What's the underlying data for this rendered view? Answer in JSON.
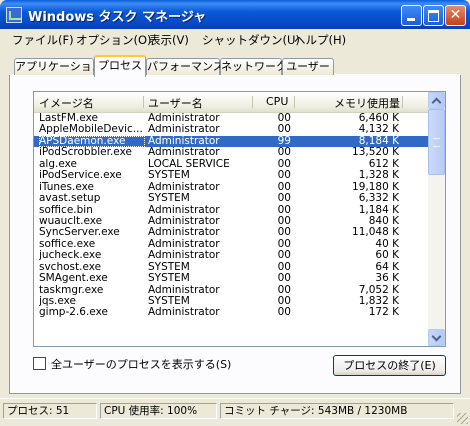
{
  "window": {
    "title": "Windows タスク マネージャ"
  },
  "menu": [
    "ファイル(F)",
    "オプション(O)",
    "表示(V)",
    "シャットダウン(U)",
    "ヘルプ(H)"
  ],
  "tabs": [
    "アプリケーション",
    "プロセス",
    "パフォーマンス",
    "ネットワーク",
    "ユーザー"
  ],
  "active_tab": "プロセス",
  "columns": [
    "イメージ名",
    "ユーザー名",
    "CPU",
    "メモリ使用量"
  ],
  "processes": [
    {
      "name": "LastFM.exe",
      "user": "Administrator",
      "cpu": "00",
      "mem": "6,460 K"
    },
    {
      "name": "AppleMobileDevic...",
      "user": "Administrator",
      "cpu": "00",
      "mem": "4,132 K"
    },
    {
      "name": "APSDaemon.exe",
      "user": "Administrator",
      "cpu": "99",
      "mem": "8,184 K",
      "selected": true
    },
    {
      "name": "iPodScrobbler.exe",
      "user": "Administrator",
      "cpu": "00",
      "mem": "13,520 K"
    },
    {
      "name": "alg.exe",
      "user": "LOCAL SERVICE",
      "cpu": "00",
      "mem": "612 K"
    },
    {
      "name": "iPodService.exe",
      "user": "SYSTEM",
      "cpu": "00",
      "mem": "1,328 K"
    },
    {
      "name": "iTunes.exe",
      "user": "Administrator",
      "cpu": "00",
      "mem": "19,180 K"
    },
    {
      "name": "avast.setup",
      "user": "SYSTEM",
      "cpu": "00",
      "mem": "6,332 K"
    },
    {
      "name": "soffice.bin",
      "user": "Administrator",
      "cpu": "00",
      "mem": "1,184 K"
    },
    {
      "name": "wuauclt.exe",
      "user": "Administrator",
      "cpu": "00",
      "mem": "840 K"
    },
    {
      "name": "SyncServer.exe",
      "user": "Administrator",
      "cpu": "00",
      "mem": "11,048 K"
    },
    {
      "name": "soffice.exe",
      "user": "Administrator",
      "cpu": "00",
      "mem": "40 K"
    },
    {
      "name": "jucheck.exe",
      "user": "Administrator",
      "cpu": "00",
      "mem": "60 K"
    },
    {
      "name": "svchost.exe",
      "user": "SYSTEM",
      "cpu": "00",
      "mem": "64 K"
    },
    {
      "name": "SMAgent.exe",
      "user": "SYSTEM",
      "cpu": "00",
      "mem": "36 K"
    },
    {
      "name": "taskmgr.exe",
      "user": "Administrator",
      "cpu": "00",
      "mem": "7,052 K"
    },
    {
      "name": "jqs.exe",
      "user": "SYSTEM",
      "cpu": "00",
      "mem": "1,832 K"
    },
    {
      "name": "gimp-2.6.exe",
      "user": "Administrator",
      "cpu": "00",
      "mem": "172 K"
    }
  ],
  "show_all_users_label": "全ユーザーのプロセスを表示する(S)",
  "end_process_label": "プロセスの終了(E)",
  "status": {
    "processes": "プロセス: 51",
    "cpu": "CPU 使用率: 100%",
    "commit": "コミット チャージ: 543MB / 1230MB"
  },
  "icons": [
    "taskmgr-app-icon",
    "minimize-icon",
    "maximize-icon",
    "close-icon",
    "scroll-up-icon",
    "scroll-down-icon",
    "resize-grip-icon"
  ]
}
